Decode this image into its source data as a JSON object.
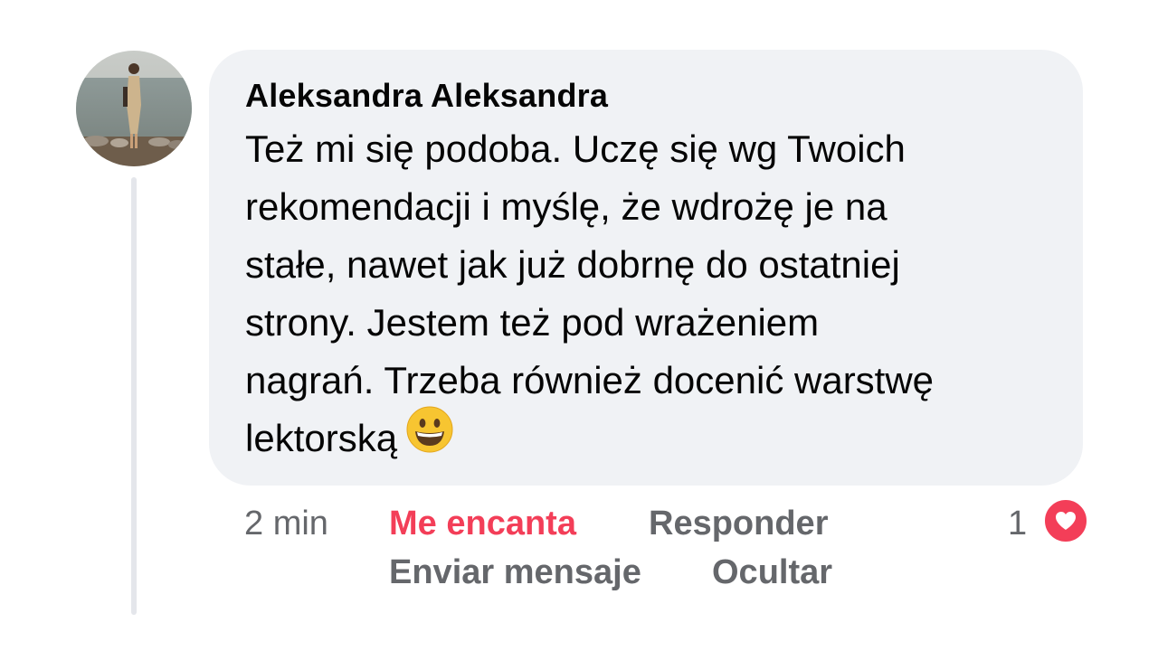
{
  "comment": {
    "author": "Aleksandra Aleksandra",
    "text_lines": [
      "Też mi się podoba. Uczę się wg Twoich",
      "rekomendacji i myślę, że wdrożę je na",
      "stałe, nawet jak już dobrnę do ostatniej",
      "strony. Jestem też pod wrażeniem",
      "nagrań. Trzeba również docenić warstwę",
      "lektorską"
    ],
    "emoji_icon": "grinning-face-emoji"
  },
  "actions": {
    "time": "2 min",
    "love": "Me encanta",
    "reply": "Responder",
    "message": "Enviar mensaje",
    "hide": "Ocultar"
  },
  "reactions": {
    "count": "1",
    "icon": "heart-icon",
    "color": "#f33e58"
  },
  "colors": {
    "bubble": "#f0f2f5",
    "secondary_text": "#65676b",
    "accent": "#f33e58",
    "thread_line": "#e4e6eb"
  }
}
